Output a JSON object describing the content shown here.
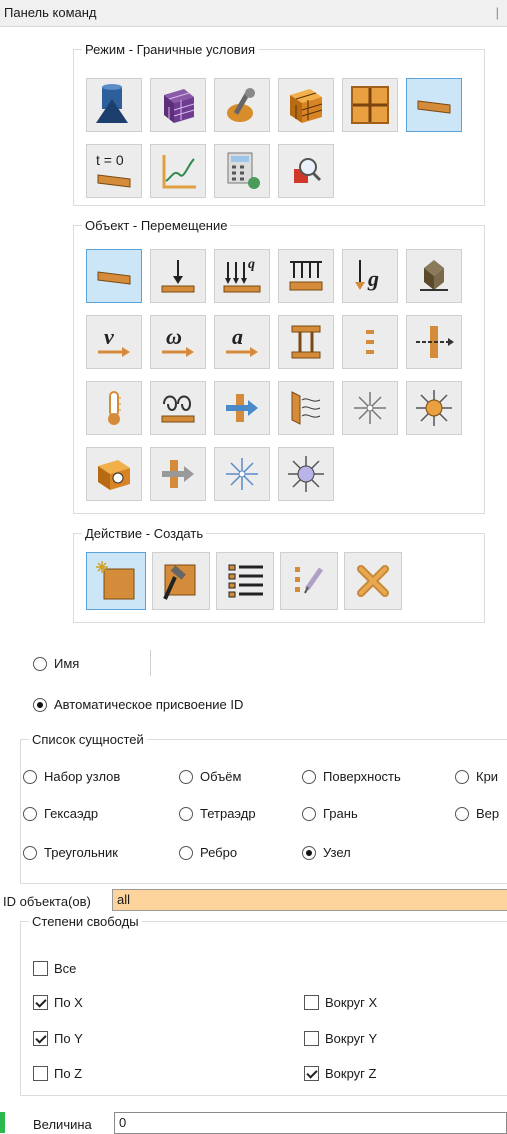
{
  "panel": {
    "title": "Панель команд"
  },
  "mode_group": {
    "legend": "Режим - Граничные условия",
    "buttons": [
      {
        "icon": "geometry-icon",
        "active": false
      },
      {
        "icon": "mesh-icon",
        "active": false
      },
      {
        "icon": "tools-icon",
        "active": false
      },
      {
        "icon": "material-block-icon",
        "active": false
      },
      {
        "icon": "grid-block-icon",
        "active": false
      },
      {
        "icon": "boundary-condition-icon",
        "active": true
      },
      {
        "icon": "initial-condition-t0-icon",
        "active": false,
        "text": "t = 0"
      },
      {
        "icon": "curve-plot-icon",
        "active": false
      },
      {
        "icon": "calculator-icon",
        "active": false
      },
      {
        "icon": "inspect-icon",
        "active": false
      }
    ]
  },
  "object_group": {
    "legend": "Объект - Перемещение",
    "buttons": [
      {
        "icon": "displacement-icon",
        "active": true
      },
      {
        "icon": "force-icon",
        "active": false
      },
      {
        "icon": "pressure-icon",
        "active": false,
        "text": "q"
      },
      {
        "icon": "distributed-load-icon",
        "active": false
      },
      {
        "icon": "gravity-icon",
        "active": false,
        "text": "g"
      },
      {
        "icon": "constraint-icon",
        "active": false
      },
      {
        "icon": "velocity-icon",
        "active": false,
        "text": "v"
      },
      {
        "icon": "angular-velocity-icon",
        "active": false,
        "text": "ω"
      },
      {
        "icon": "acceleration-icon",
        "active": false,
        "text": "a"
      },
      {
        "icon": "contact-icon",
        "active": false
      },
      {
        "icon": "spring-icon",
        "active": false
      },
      {
        "icon": "axial-load-icon",
        "active": false
      },
      {
        "icon": "temperature-icon",
        "active": false
      },
      {
        "icon": "heat-flux-icon",
        "active": false
      },
      {
        "icon": "convection-icon",
        "active": false
      },
      {
        "icon": "radiation-icon",
        "active": false
      },
      {
        "icon": "point-source-icon",
        "active": false
      },
      {
        "icon": "heat-source-icon",
        "active": false
      },
      {
        "icon": "heat-generation-icon",
        "active": false
      },
      {
        "icon": "flow-icon",
        "active": false
      },
      {
        "icon": "point-source-2-icon",
        "active": false
      },
      {
        "icon": "heat-source-2-icon",
        "active": false
      }
    ]
  },
  "action_group": {
    "legend": "Действие - Создать",
    "buttons": [
      {
        "icon": "create-icon",
        "active": true
      },
      {
        "icon": "modify-icon",
        "active": false
      },
      {
        "icon": "list-icon",
        "active": false
      },
      {
        "icon": "rename-icon",
        "active": false
      },
      {
        "icon": "delete-icon",
        "active": false
      }
    ]
  },
  "name_option": {
    "label": "Имя",
    "value": ""
  },
  "auto_id_option": {
    "label": "Автоматическое присвоение ID"
  },
  "entity_list": {
    "legend": "Список сущностей",
    "options": [
      {
        "label": "Набор узлов",
        "selected": false
      },
      {
        "label": "Объём",
        "selected": false
      },
      {
        "label": "Поверхность",
        "selected": false
      },
      {
        "label": "Кри",
        "selected": false
      },
      {
        "label": "Гексаэдр",
        "selected": false
      },
      {
        "label": "Тетраэдр",
        "selected": false
      },
      {
        "label": "Грань",
        "selected": false
      },
      {
        "label": "Вер",
        "selected": false
      },
      {
        "label": "Треугольник",
        "selected": false
      },
      {
        "label": "Ребро",
        "selected": false
      },
      {
        "label": "Узел",
        "selected": true
      }
    ]
  },
  "object_ids": {
    "label": "ID объекта(ов)",
    "value": "all"
  },
  "dof": {
    "legend": "Степени свободы",
    "all": {
      "label": "Все",
      "checked": false
    },
    "items": [
      {
        "label": "По X",
        "checked": true
      },
      {
        "label": "Вокруг X",
        "checked": false
      },
      {
        "label": "По Y",
        "checked": true
      },
      {
        "label": "Вокруг Y",
        "checked": false
      },
      {
        "label": "По Z",
        "checked": false
      },
      {
        "label": "Вокруг Z",
        "checked": true
      }
    ]
  },
  "magnitude": {
    "label": "Величина",
    "value": "0"
  },
  "colors": {
    "accent_active": "#cde6f7",
    "field_highlight": "#fcd49c",
    "status_green": "#2db84b"
  }
}
